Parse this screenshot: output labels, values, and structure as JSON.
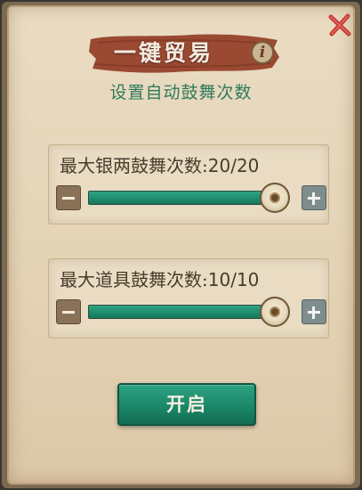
{
  "dialog": {
    "title": "一键贸易",
    "info_icon": "i",
    "subtitle": "设置自动鼓舞次数"
  },
  "sliders": [
    {
      "label": "最大银两鼓舞次数:",
      "value_text": "20/20",
      "value": 20,
      "max": 20,
      "fill_fraction": 1.0
    },
    {
      "label": "最大道具鼓舞次数:",
      "value_text": "10/10",
      "value": 10,
      "max": 10,
      "fill_fraction": 1.0
    }
  ],
  "confirm_button": {
    "label": "开启"
  },
  "icons": {
    "close": "close-x-icon",
    "info": "info-icon",
    "minus": "minus-icon",
    "plus": "plus-icon",
    "knob": "slider-knob-icon"
  },
  "colors": {
    "accent_green": "#1f8d6d",
    "title_banner": "#9a4a32",
    "close_red": "#c63a3a",
    "subtitle_green": "#2f7a5c"
  }
}
